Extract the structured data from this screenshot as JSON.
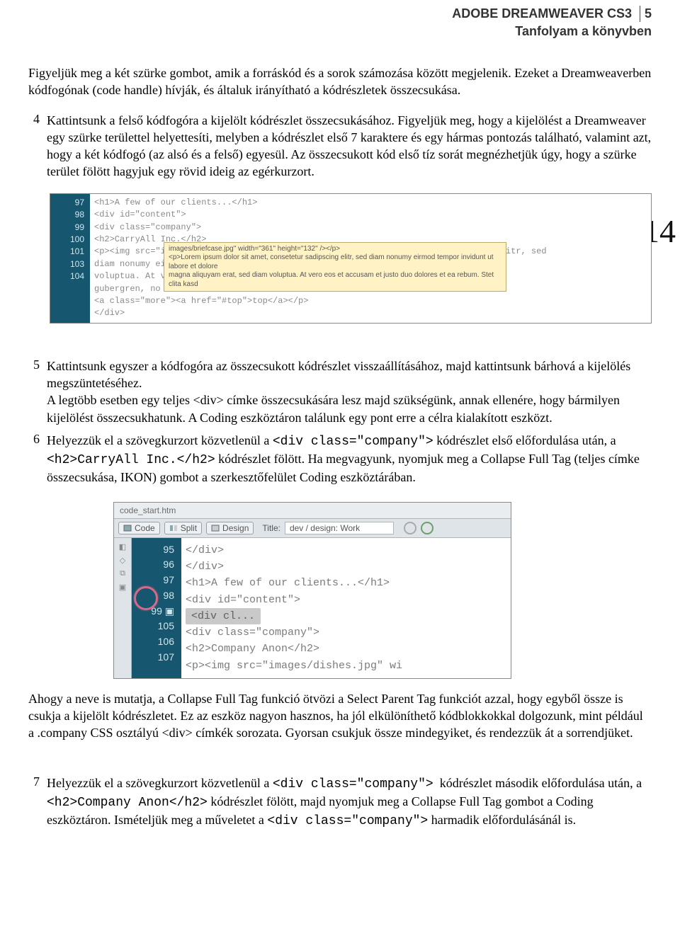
{
  "header": {
    "line1_prefix": "ADOBE DREAMWEAVER CS3",
    "page_number": "5",
    "line2": "Tanfolyam a könyvben"
  },
  "intro": "Figyeljük meg a két szürke gombot, amik a forráskód és a sorok számozása között megjelenik. Ezeket a Dreamweaverben kódfogónak (code handle) hívják, és általuk irányítható a kódrészletek összecsukása.",
  "step4": {
    "num": "4",
    "body": "Kattintsunk a felső kódfogóra a kijelölt kódrészlet összecsukásához. Figyeljük meg, hogy a kijelölést a Dreamweaver egy szürke területtel helyettesíti, melyben a kódrészlet első 7 karaktere és egy hármas pontozás található, valamint azt, hogy a két kódfogó (az alsó és a felső) egyesül. Az összecsukott kód első tíz sorát megnézhetjük úgy, hogy a szürke terület fölött hagyjuk egy rövid ideig az egérkurzort."
  },
  "big_page_number": "14",
  "shot1": {
    "lines": [
      "97",
      "98",
      "99",
      "100",
      "101",
      "",
      "",
      "",
      "103",
      "104"
    ],
    "code_l1": "<h1>A few of our clients...</h1>",
    "code_l2": "<div id=\"content\">",
    "code_l3": "<div class=\"company\">",
    "code_l4": "  <h2>CarryAll Inc.</h2>",
    "code_l5a": "  <p><img src=\"i",
    "chip": "mages/b...",
    "code_l5b": "\", Lorem ipsum dolor sit amet, consetetur sadipscing elitr, sed",
    "code_l6": "diam nonumy eirmod temp",
    "tooltip_line1": "images/briefcase.jpg\" width=\"361\" height=\"132\" /></p>",
    "tooltip_line2": "<p>Lorem ipsum dolor sit amet, consetetur sadipscing elitr, sed diam nonumy eirmod tempor invidunt ut labore et dolore",
    "tooltip_line3": "magna aliquyam erat, sed diam voluptua. At vero eos et accusam et justo duo dolores et ea rebum. Stet clita kasd",
    "code_l7": "voluptua. At vero eos e",
    "code_l8": "gubergren, no sea takim",
    "code_l9": "<a class=\"more\"><a href=\"#top\">top</a></p>",
    "code_l10": "</div>"
  },
  "step5": {
    "num": "5",
    "body": "Kattintsunk egyszer a kódfogóra az összecsukott kódrészlet visszaállításához, majd kattintsunk bárhová a kijelölés megszüntetéséhez.\nA legtöbb esetben egy teljes <div> címke összecsukására lesz majd szükségünk, annak ellenére, hogy bármilyen kijelölést összecsukhatunk. A Coding eszköztáron találunk egy pont erre a célra kialakított eszközt."
  },
  "step6": {
    "num": "6",
    "body": "Helyezzük el a szövegkurzort közvetlenül a <div class=\"company\"> kódrészlet első előfordulása után, a <h2>CarryAll Inc.</h2> kódrészlet fölött. Ha megvagyunk, nyomjuk meg a Collapse Full Tag (teljes címke összecsukása, IKON) gombot a szerkesztőfelület Coding eszköztárában."
  },
  "shot2": {
    "tab": "code_start.htm",
    "btn_code": "Code",
    "btn_split": "Split",
    "btn_design": "Design",
    "title_label": "Title:",
    "title_value": "dev / design: Work",
    "lines": [
      "95",
      "96",
      "97",
      "98",
      "99",
      "105",
      "106",
      "107"
    ],
    "code_l1": "    </div>",
    "code_l2": "  </div>",
    "code_l3": "<h1>A few of our clients...</h1>",
    "code_l4": "<div id=\"content\">",
    "collapsed": "<div cl...",
    "code_l6": "<div class=\"company\">",
    "code_l7": "<h2>Company Anon</h2>",
    "code_l8": "<p><img src=\"images/dishes.jpg\" wi"
  },
  "after2": "Ahogy a neve is mutatja, a Collapse Full Tag funkció ötvözi a Select Parent Tag funkciót azzal, hogy egyből össze is csukja a kijelölt kódrészletet. Ez az eszköz nagyon hasznos, ha jól elkülöníthető kódblokkokkal dolgozunk, mint például a .company CSS osztályú <div> címkék sorozata. Gyorsan csukjuk össze mindegyiket, és rendezzük át a sorrendjüket.",
  "step7": {
    "num": "7",
    "body": "Helyezzük el a szövegkurzort közvetlenül a <div class=\"company\"> kódrészlet második előfordulása után, a <h2>Company Anon</h2> kódrészlet fölött, majd nyomjuk meg a Collapse Full Tag gombot a Coding eszköztáron. Ismételjük meg a műveletet a <div class=\"company\"> harmadik előfordulásánál is."
  }
}
